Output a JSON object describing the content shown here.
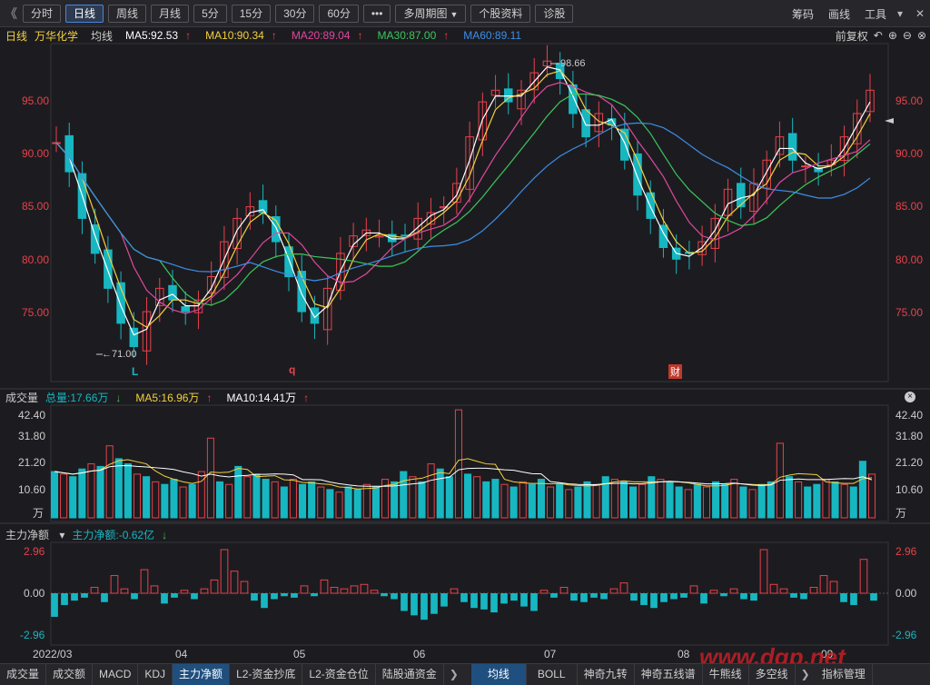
{
  "toolbar": {
    "back": "《",
    "periods": [
      {
        "label": "分时",
        "active": false
      },
      {
        "label": "日线",
        "active": true
      },
      {
        "label": "周线",
        "active": false
      },
      {
        "label": "月线",
        "active": false
      },
      {
        "label": "5分",
        "active": false
      },
      {
        "label": "15分",
        "active": false
      },
      {
        "label": "30分",
        "active": false
      },
      {
        "label": "60分",
        "active": false
      }
    ],
    "more": "•••",
    "multi_period": "多周期图",
    "stock_info": "个股资料",
    "diagnose": "诊股",
    "chips": "筹码",
    "draw": "画线",
    "tools": "工具"
  },
  "main_panel": {
    "period": "日线",
    "stock": "万华化学",
    "ma_title": "均线",
    "ma5": "MA5:92.53",
    "ma10": "MA10:90.34",
    "ma20": "MA20:89.04",
    "ma30": "MA30:87.00",
    "ma60": "MA60:89.11",
    "adjust": "前复权",
    "y_ticks": [
      "95.00",
      "90.00",
      "85.00",
      "80.00",
      "75.00"
    ],
    "high_label": "98.66",
    "low_label": "←71.00",
    "markers": [
      "L",
      "q",
      "财"
    ]
  },
  "volume_panel": {
    "title": "成交量",
    "total": "总量:17.66万",
    "ma5": "MA5:16.96万",
    "ma10": "MA10:14.41万",
    "y_ticks": [
      "42.40",
      "31.80",
      "21.20",
      "10.60"
    ],
    "unit": "万"
  },
  "flow_panel": {
    "title": "主力净额",
    "value": "主力净额:-0.62亿",
    "y_ticks": [
      "2.96",
      "0.00",
      "-2.96"
    ]
  },
  "x_axis": [
    "2022/03",
    "04",
    "05",
    "06",
    "07",
    "08",
    "09"
  ],
  "bottom_tabs": {
    "left": [
      "成交量",
      "成交额",
      "MACD",
      "KDJ",
      "主力净额",
      "L2-资金抄底",
      "L2-资金仓位",
      "陆股通资金"
    ],
    "active_left": "主力净额",
    "right": [
      "均线",
      "BOLL",
      "神奇九转",
      "神奇五线谱",
      "牛熊线",
      "多空线",
      "指标管理"
    ],
    "active_right": "均线"
  },
  "watermark": "www.dgp.net",
  "colors": {
    "up": "#e8414b",
    "down": "#17b7c2",
    "ma5": "#ffffff",
    "ma10": "#f4d03f",
    "ma20": "#e0489e",
    "ma30": "#3cc75b",
    "ma60": "#3d8ee8",
    "accent": "#3a7bd5"
  },
  "chart_data": [
    {
      "type": "candlestick",
      "title": "万华化学 日线",
      "x": [
        "2022/03",
        "04",
        "05",
        "06",
        "07",
        "08",
        "09"
      ],
      "ylim": [
        70,
        99
      ],
      "price_path": [
        90.5,
        88,
        84,
        81,
        78,
        75,
        73,
        76,
        78,
        77,
        76,
        77,
        79,
        82,
        84,
        85,
        84.5,
        82,
        79,
        76,
        75,
        78,
        81,
        82.5,
        83,
        82.5,
        82,
        82.5,
        84,
        84.5,
        85,
        87,
        91,
        94,
        95,
        94,
        95,
        96.5,
        97.5,
        96,
        93,
        91,
        93,
        92,
        89,
        86,
        84,
        81.5,
        80.5,
        81,
        82,
        84,
        86.5,
        85,
        87,
        89,
        91,
        89,
        88.5,
        88,
        89,
        91,
        93,
        95
      ],
      "series": [
        {
          "name": "MA5",
          "last": 92.53
        },
        {
          "name": "MA10",
          "last": 90.34
        },
        {
          "name": "MA20",
          "last": 89.04
        },
        {
          "name": "MA30",
          "last": 87.0
        },
        {
          "name": "MA60",
          "last": 89.11
        }
      ],
      "annotations": [
        {
          "label": "98.66",
          "type": "high"
        },
        {
          "label": "71.00",
          "type": "low"
        }
      ]
    },
    {
      "type": "bar",
      "title": "成交量",
      "unit": "万",
      "ylim": [
        0,
        42.4
      ],
      "values": [
        18,
        17,
        16,
        19,
        21,
        20,
        28,
        23,
        21,
        17,
        16,
        14,
        13,
        15,
        12,
        13,
        18,
        31,
        14,
        13,
        20,
        16,
        17,
        15,
        14,
        12,
        15,
        13,
        14,
        12,
        11,
        10,
        12,
        11,
        13,
        12,
        15,
        14,
        18,
        16,
        14,
        21,
        19,
        16,
        42,
        17,
        16,
        14,
        15,
        13,
        12,
        14,
        13,
        15,
        12,
        13,
        11,
        12,
        14,
        13,
        16,
        15,
        14,
        12,
        13,
        16,
        15,
        14,
        12,
        11,
        13,
        12,
        14,
        13,
        15,
        12,
        11,
        13,
        14,
        29,
        16,
        14,
        12,
        13,
        15,
        14,
        13,
        12,
        22,
        17
      ]
    },
    {
      "type": "bar",
      "title": "主力净额",
      "unit": "亿",
      "ylim": [
        -2.96,
        2.96
      ],
      "values": [
        -1.6,
        -0.8,
        -0.5,
        -0.3,
        0.4,
        -0.6,
        1.2,
        0.3,
        -0.4,
        1.6,
        0.5,
        -0.7,
        -0.3,
        0.2,
        -0.4,
        0.3,
        0.9,
        2.96,
        1.5,
        0.8,
        -0.5,
        -1.0,
        -0.4,
        -0.2,
        -0.3,
        0.5,
        -0.2,
        0.9,
        0.4,
        0.3,
        0.5,
        0.6,
        0.2,
        -0.2,
        -0.4,
        -1.2,
        -1.5,
        -1.8,
        -1.4,
        -0.9,
        0.3,
        -0.6,
        -1.0,
        -1.1,
        -1.3,
        -0.7,
        -0.5,
        -0.9,
        -1.2,
        0.2,
        -0.3,
        0.4,
        -0.5,
        -0.6,
        -0.3,
        -0.4,
        0.3,
        0.7,
        -0.5,
        -0.8,
        -1.0,
        -0.6,
        -0.4,
        -0.3,
        0.5,
        -0.7,
        0.2,
        -0.2,
        0.3,
        -0.4,
        -0.5,
        2.96,
        0.6,
        0.3,
        -0.3,
        -0.4,
        0.4,
        1.2,
        0.8,
        -0.6,
        -0.8,
        2.3,
        -0.5
      ]
    }
  ]
}
